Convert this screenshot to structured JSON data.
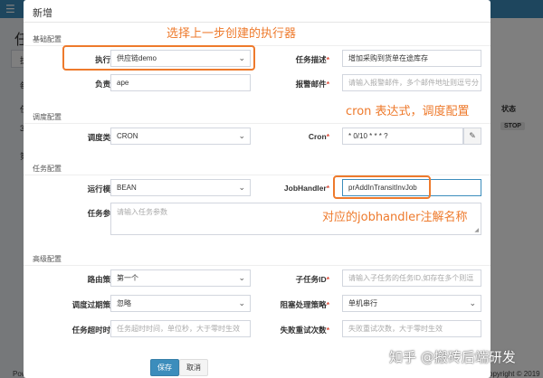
{
  "background": {
    "title": "任",
    "left_texts": [
      "执",
      "每",
      "任",
      "3",
      "第"
    ],
    "status_header": "状态",
    "stop_badge": "STOP",
    "footer_left": "Pow",
    "footer_right": "opyright © 2019"
  },
  "modal": {
    "title": "新增",
    "sections": {
      "basic": "基础配置",
      "schedule": "调度配置",
      "task": "任务配置",
      "advanced": "高级配置"
    },
    "fields": {
      "executor": {
        "label": "执行器",
        "value": "供应链demo"
      },
      "job_desc": {
        "label": "任务描述",
        "value": "增加采购到货单在途库存"
      },
      "owner": {
        "label": "负责人",
        "value": "ape"
      },
      "alarm_email": {
        "label": "报警邮件",
        "placeholder": "请输入报警邮件，多个邮件地址则逗号分"
      },
      "schedule_type": {
        "label": "调度类型",
        "value": "CRON"
      },
      "cron": {
        "label": "Cron",
        "value": "* 0/10 * * * ?"
      },
      "run_mode": {
        "label": "运行模式",
        "value": "BEAN"
      },
      "job_handler": {
        "label": "JobHandler",
        "value": "prAddInTransitInvJob"
      },
      "job_param": {
        "label": "任务参数",
        "placeholder": "请输入任务参数"
      },
      "route_strategy": {
        "label": "路由策略",
        "value": "第一个"
      },
      "child_job_id": {
        "label": "子任务ID",
        "placeholder": "请输入子任务的任务ID,如存在多个则逗"
      },
      "misfire_strategy": {
        "label": "调度过期策略",
        "value": "忽略"
      },
      "block_strategy": {
        "label": "阻塞处理策略",
        "value": "单机串行"
      },
      "timeout": {
        "label": "任务超时时间",
        "placeholder": "任务超时时间，单位秒，大于零时生效"
      },
      "fail_retry": {
        "label": "失败重试次数",
        "placeholder": "失败重试次数，大于零时生效"
      }
    },
    "required_mark": "*",
    "buttons": {
      "save": "保存",
      "cancel": "取消"
    }
  },
  "annotations": {
    "executor_note": "选择上一步创建的执行器",
    "cron_note": "cron 表达式，调度配置",
    "jobhandler_note": "对应的jobhandler注解名称"
  },
  "watermark": "知乎 @搬砖后端研发",
  "colors": {
    "accent": "#3c8dbc",
    "annotation": "#ee7a2c",
    "required": "#dd4b39"
  }
}
